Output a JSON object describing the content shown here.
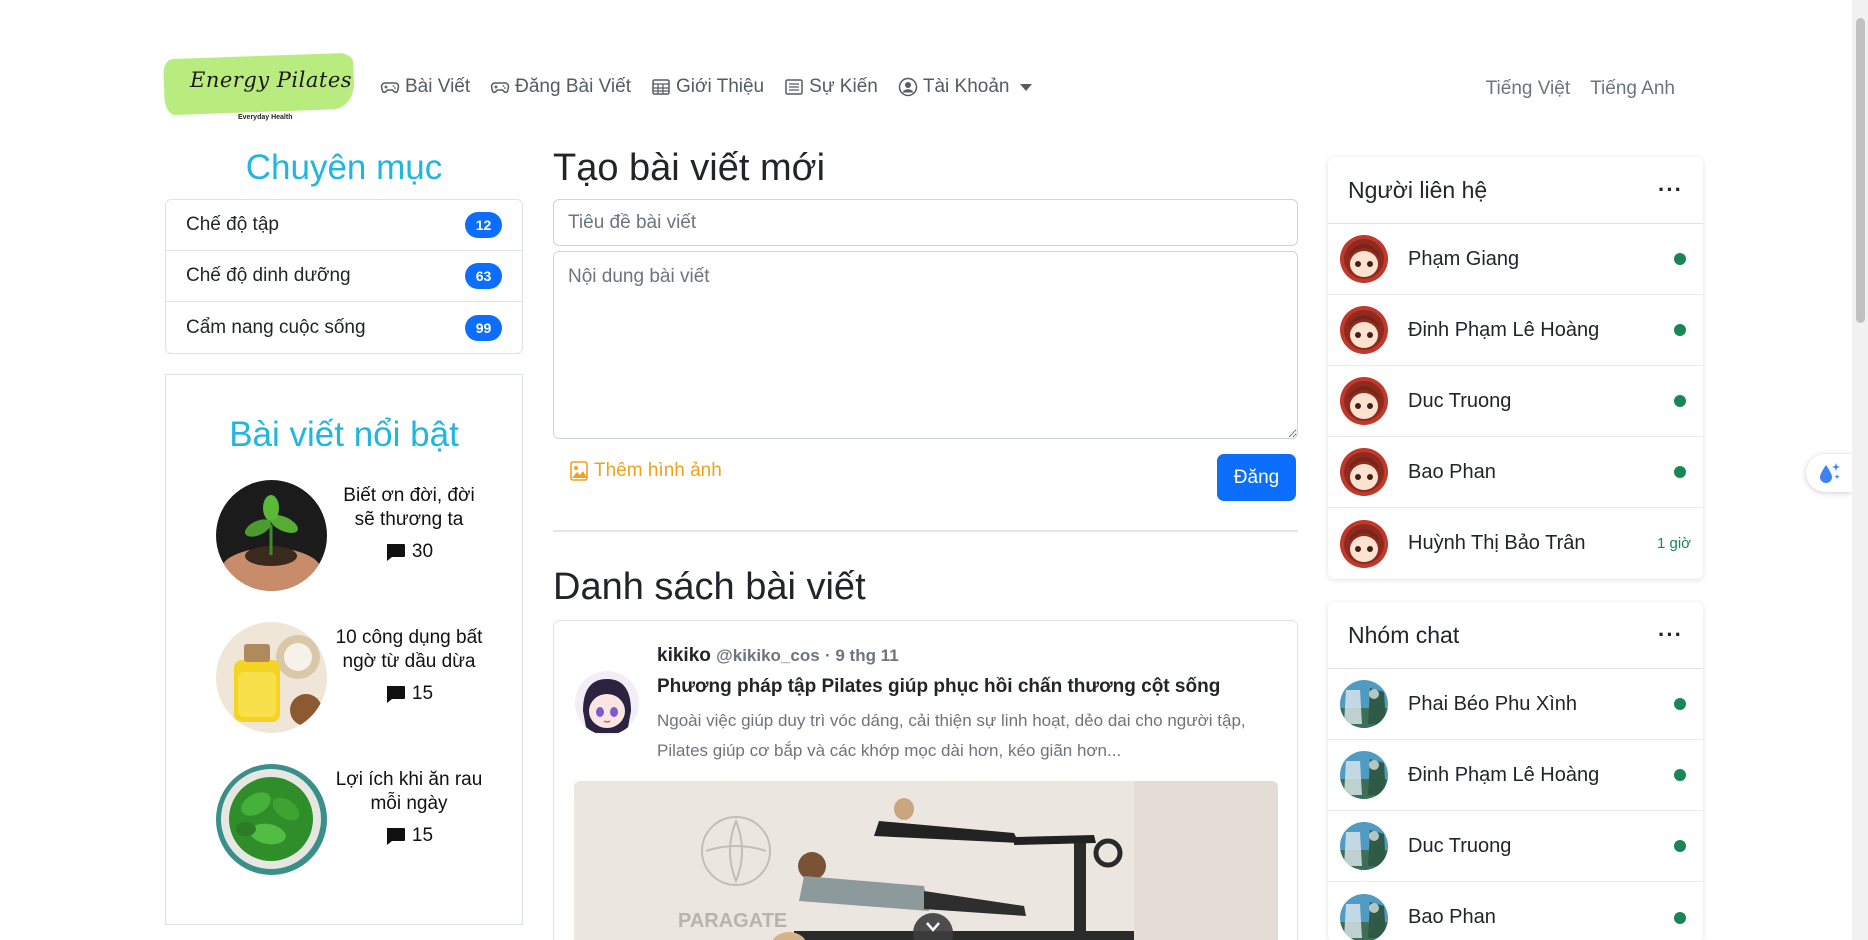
{
  "brand": {
    "logo_text": "Energy Pilates",
    "logo_subtext": "Everyday Health",
    "logo_color": "#b9ec7e"
  },
  "nav": {
    "items": [
      {
        "label": "Bài Viết",
        "icon": "gamepad-icon"
      },
      {
        "label": "Đăng Bài Viết",
        "icon": "gamepad-icon"
      },
      {
        "label": "Giới Thiệu",
        "icon": "table-icon"
      },
      {
        "label": "Sự Kiến",
        "icon": "card-list-icon"
      },
      {
        "label": "Tài Khoản",
        "icon": "person-circle-icon"
      }
    ],
    "languages": [
      "Tiếng Việt",
      "Tiếng Anh"
    ]
  },
  "categories": {
    "title": "Chuyên mục",
    "items": [
      {
        "label": "Chế độ tập",
        "count": "12"
      },
      {
        "label": "Chế độ dinh dưỡng",
        "count": "63"
      },
      {
        "label": "Cẩm nang cuộc sống",
        "count": "99"
      }
    ]
  },
  "featured": {
    "title": "Bài viết nổi bật",
    "items": [
      {
        "title": "Biết ơn đời, đời sẽ thương ta",
        "comments": "30"
      },
      {
        "title": "10 công dụng bất ngờ từ dầu dừa",
        "comments": "15"
      },
      {
        "title": "Lợi ích khi ăn rau mỗi ngày",
        "comments": "15"
      }
    ]
  },
  "create_post": {
    "heading": "Tạo bài viết mới",
    "title_placeholder": "Tiêu đề bài viết",
    "content_placeholder": "Nội dung bài viết",
    "add_image_label": "Thêm hình ảnh",
    "submit_label": "Đăng"
  },
  "post_list": {
    "heading": "Danh sách bài viết",
    "posts": [
      {
        "author": "kikiko",
        "handle": "@kikiko_cos",
        "date": "· 9 thg 11",
        "title": "Phương pháp tập Pilates giúp phục hồi chấn thương cột sống",
        "excerpt": "Ngoài việc giúp duy trì vóc dáng, cải thiện sự linh hoạt, dẻo dai cho người tập, Pilates giúp cơ bắp và các khớp mọc dài hơn, kéo giãn hơn...",
        "image_watermark": "PARAGATE"
      }
    ]
  },
  "contacts": {
    "title": "Người liên hệ",
    "items": [
      {
        "name": "Phạm Giang",
        "status": "online"
      },
      {
        "name": "Đinh Phạm Lê Hoàng",
        "status": "online"
      },
      {
        "name": "Duc Truong",
        "status": "online"
      },
      {
        "name": "Bao Phan",
        "status": "online"
      },
      {
        "name": "Huỳnh Thị Bảo Trân",
        "status": "1 giờ"
      }
    ]
  },
  "groups": {
    "title": "Nhóm chat",
    "items": [
      {
        "name": "Phai Béo Phu Xình",
        "status": "online"
      },
      {
        "name": "Đinh Phạm Lê Hoàng",
        "status": "online"
      },
      {
        "name": "Duc Truong",
        "status": "online"
      },
      {
        "name": "Bao Phan",
        "status": "online"
      }
    ]
  },
  "colors": {
    "accent": "#20b6e2",
    "primary": "#0d6efd",
    "online": "#198754",
    "warning": "#f0a020"
  }
}
